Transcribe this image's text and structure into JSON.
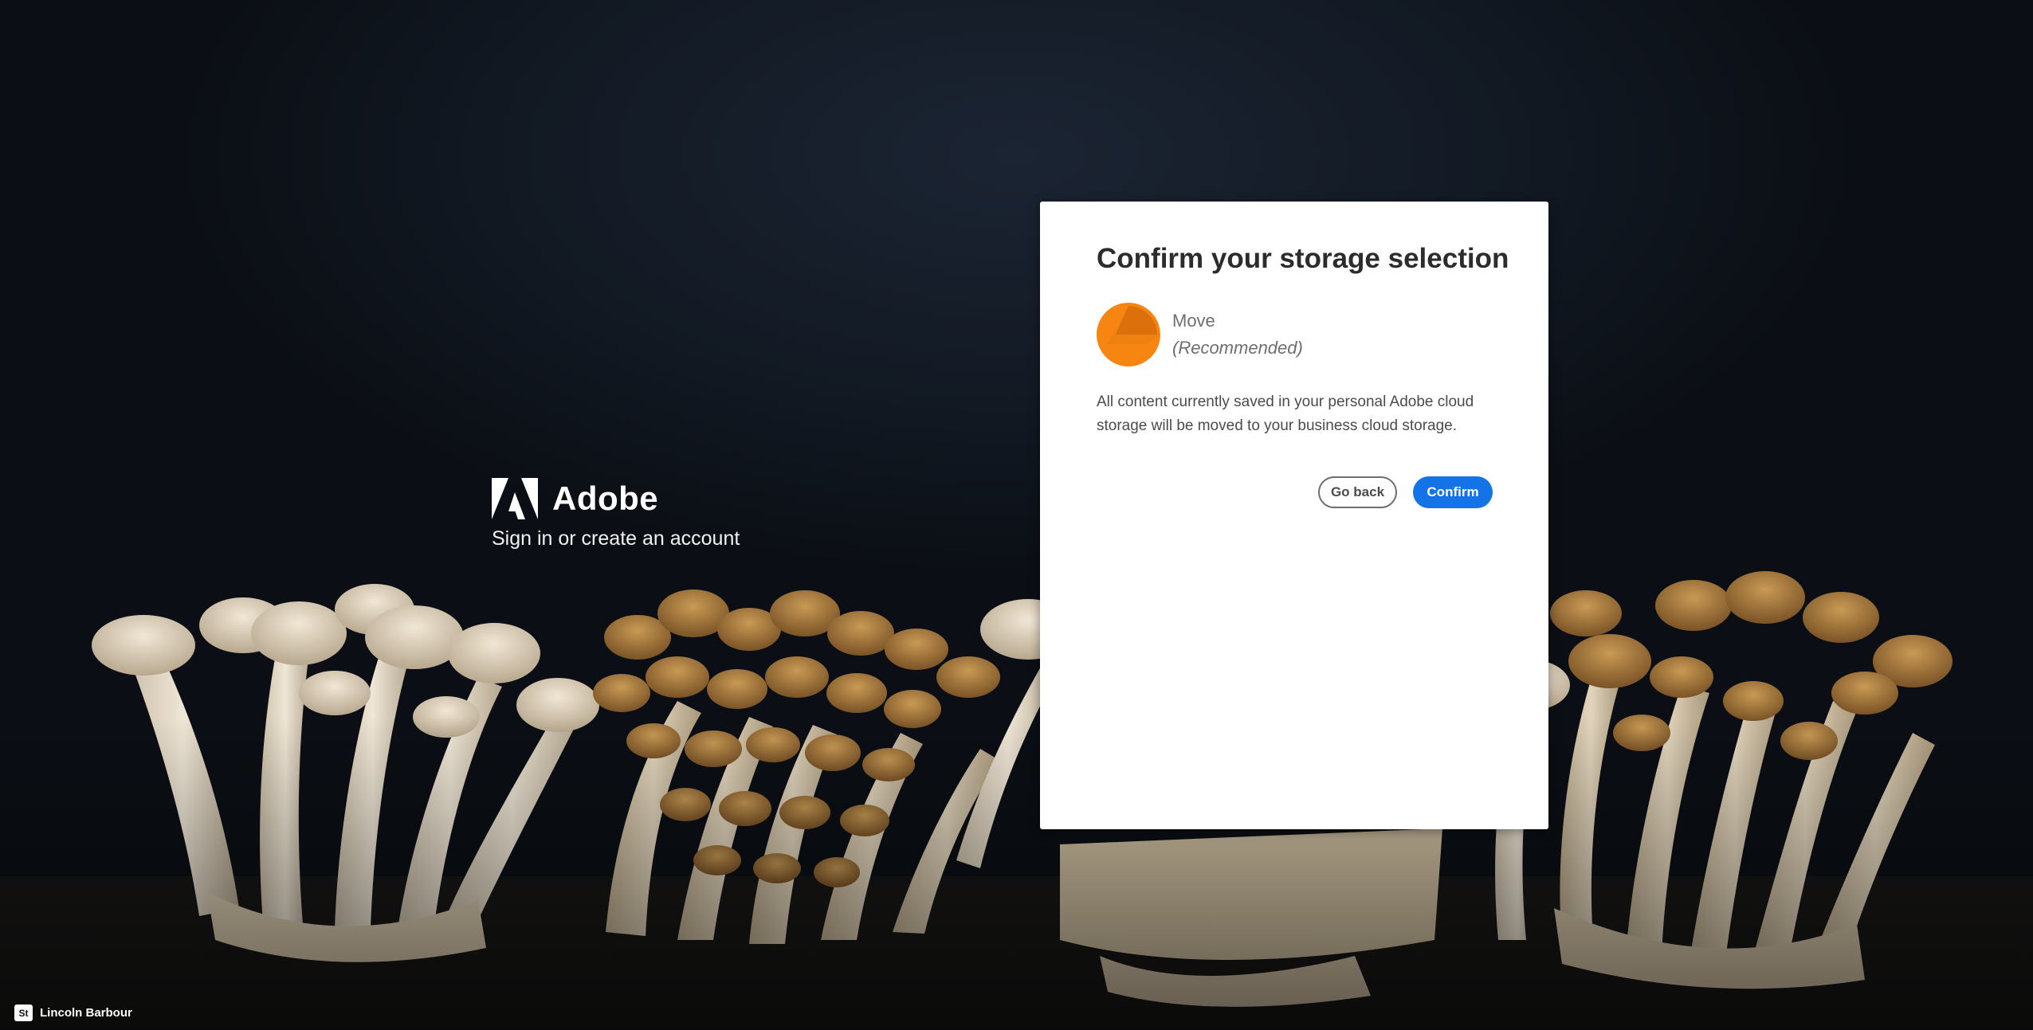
{
  "brand": {
    "name": "Adobe",
    "tagline": "Sign in or create an account"
  },
  "dialog": {
    "title": "Confirm your storage selection",
    "option": {
      "name": "Move",
      "note": "(Recommended)",
      "icon": "storage-move-icon",
      "icon_color": "#f68511"
    },
    "description": "All content currently saved in your personal Adobe cloud storage will be moved to your business cloud storage.",
    "buttons": {
      "back_label": "Go back",
      "confirm_label": "Confirm"
    },
    "accent_color": "#1473e6"
  },
  "photo_credit": {
    "badge": "St",
    "name": "Lincoln Barbour"
  }
}
